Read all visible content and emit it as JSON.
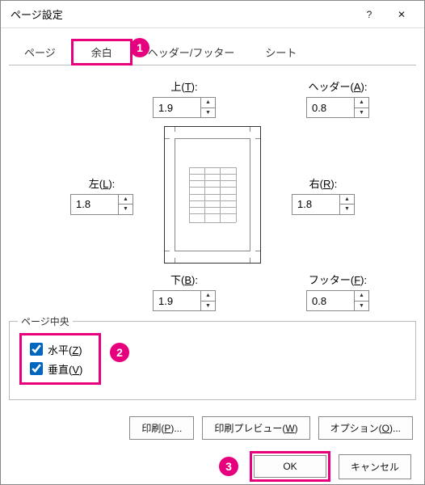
{
  "title": "ページ設定",
  "tabs": [
    "ページ",
    "余白",
    "ヘッダー/フッター",
    "シート"
  ],
  "activeTabIndex": 1,
  "margins": {
    "top": {
      "label": "上(T):",
      "value": "1.9",
      "accel": "T"
    },
    "header": {
      "label": "ヘッダー(A):",
      "value": "0.8",
      "accel": "A"
    },
    "left": {
      "label": "左(L):",
      "value": "1.8",
      "accel": "L"
    },
    "right": {
      "label": "右(R):",
      "value": "1.8",
      "accel": "R"
    },
    "bottom": {
      "label": "下(B):",
      "value": "1.9",
      "accel": "B"
    },
    "footer": {
      "label": "フッター(F):",
      "value": "0.8",
      "accel": "F"
    }
  },
  "center": {
    "legend": "ページ中央",
    "horizontal": {
      "label": "水平(Z)",
      "checked": true,
      "accel": "Z"
    },
    "vertical": {
      "label": "垂直(V)",
      "checked": true,
      "accel": "V"
    }
  },
  "buttons": {
    "print": "印刷(P)...",
    "preview": "印刷プレビュー(W)",
    "options": "オプション(O)...",
    "ok": "OK",
    "cancel": "キャンセル"
  },
  "callouts": {
    "one": "1",
    "two": "2",
    "three": "3"
  },
  "titlebar": {
    "help": "?",
    "close": "✕"
  }
}
